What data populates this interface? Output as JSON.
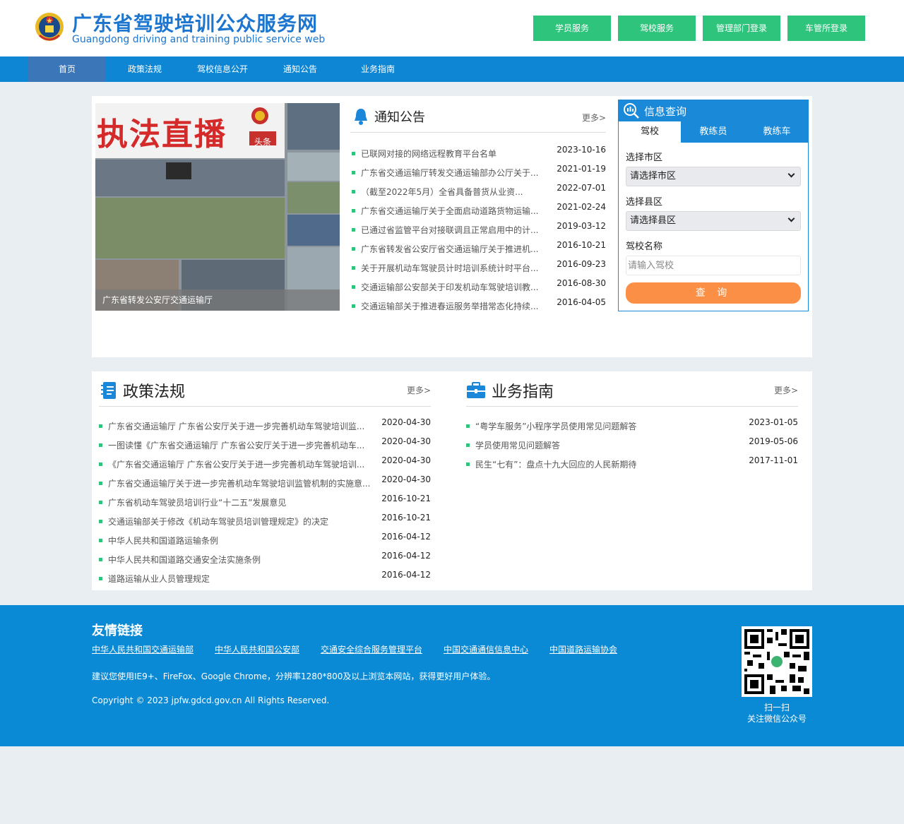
{
  "header": {
    "title": "广东省驾驶培训公众服务网",
    "subtitle": "Guangdong driving and training public service web",
    "buttons": [
      "学员服务",
      "驾校服务",
      "管理部门登录",
      "车管所登录"
    ]
  },
  "nav": {
    "items": [
      "首页",
      "政策法规",
      "驾校信息公开",
      "通知公告",
      "业务指南"
    ],
    "active_index": 0
  },
  "slider": {
    "caption": "广东省转发公安厅交通运输厅",
    "banner_text": "执法直播",
    "badge_text": "头条"
  },
  "notices": {
    "title": "通知公告",
    "more": "更多>",
    "items": [
      {
        "text": "已联网对接的网络远程教育平台名单",
        "date": "2023-10-16"
      },
      {
        "text": "广东省交通运输厅转发交通运输部办公厅关于...",
        "date": "2021-01-19"
      },
      {
        "text": "（截至2022年5月）全省具备普货从业资...",
        "date": "2022-07-01"
      },
      {
        "text": "广东省交通运输厅关于全面启动道路货物运输...",
        "date": "2021-02-24"
      },
      {
        "text": "已通过省监管平台对接联调且正常启用中的计...",
        "date": "2019-03-12"
      },
      {
        "text": "广东省转发省公安厅省交通运输厅关于推进机...",
        "date": "2016-10-21"
      },
      {
        "text": "关于开展机动车驾驶员计时培训系统计时平台...",
        "date": "2016-09-23"
      },
      {
        "text": "交通运输部公安部关于印发机动车驾驶培训教...",
        "date": "2016-08-30"
      },
      {
        "text": "交通运输部关于推进春运服务举措常态化持续...",
        "date": "2016-04-05"
      }
    ]
  },
  "query": {
    "title": "信息查询",
    "tabs": [
      "驾校",
      "教练员",
      "教练车"
    ],
    "active_tab": 0,
    "city_label": "选择市区",
    "city_value": "请选择市区",
    "county_label": "选择县区",
    "county_value": "请选择县区",
    "school_label": "驾校名称",
    "school_placeholder": "请输入驾校",
    "submit": "查 询"
  },
  "policy": {
    "title": "政策法规",
    "more": "更多>",
    "items": [
      {
        "text": "广东省交通运输厅 广东省公安厅关于进一步完善机动车驾驶培训监...",
        "date": "2020-04-30"
      },
      {
        "text": "一图读懂《广东省交通运输厅 广东省公安厅关于进一步完善机动车...",
        "date": "2020-04-30"
      },
      {
        "text": "《广东省交通运输厅 广东省公安厅关于进一步完善机动车驾驶培训...",
        "date": "2020-04-30"
      },
      {
        "text": "广东省交通运输厅关于进一步完善机动车驾驶培训监管机制的实施意...",
        "date": "2020-04-30"
      },
      {
        "text": "广东省机动车驾驶员培训行业“十二五”发展意见",
        "date": "2016-10-21"
      },
      {
        "text": "交通运输部关于修改《机动车驾驶员培训管理规定》的决定",
        "date": "2016-10-21"
      },
      {
        "text": "中华人民共和国道路运输条例",
        "date": "2016-04-12"
      },
      {
        "text": "中华人民共和国道路交通安全法实施条例",
        "date": "2016-04-12"
      },
      {
        "text": "道路运输从业人员管理规定",
        "date": "2016-04-12"
      }
    ]
  },
  "guide": {
    "title": "业务指南",
    "more": "更多>",
    "items": [
      {
        "text": "“粤学车服务”小程序学员使用常见问题解答",
        "date": "2023-01-05"
      },
      {
        "text": "学员使用常见问题解答",
        "date": "2019-05-06"
      },
      {
        "text": "民生“七有”：盘点十九大回应的人民新期待",
        "date": "2017-11-01"
      }
    ]
  },
  "footer": {
    "links_title": "友情链接",
    "links": [
      "中华人民共和国交通运输部",
      "中华人民共和国公安部",
      "交通安全综合服务管理平台",
      "中国交通通信信息中心",
      "中国道路运输协会"
    ],
    "browser_note": "建议您使用IE9+、FireFox、Google Chrome，分辨率1280*800及以上浏览本网站，获得更好用户体验。",
    "copyright": "Copyright © 2023 jpfw.gdcd.gov.cn All Rights Reserved.",
    "qr_line1": "扫一扫",
    "qr_line2": "关注微信公众号"
  },
  "colors": {
    "brand_blue": "#0f86d4",
    "nav_active": "#3a76b8",
    "green": "#2ec47c",
    "orange": "#fb8f45"
  }
}
